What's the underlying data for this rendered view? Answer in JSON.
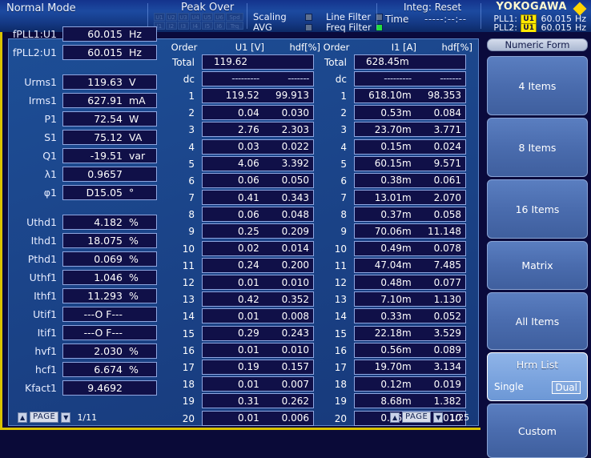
{
  "topbar": {
    "mode": "Normal Mode",
    "peak_over_title": "Peak Over",
    "peak_over_row1": [
      "U1",
      "U2",
      "U3",
      "U4",
      "U5",
      "U6",
      "Spd"
    ],
    "peak_over_row2": [
      "I1",
      "I2",
      "I3",
      "I4",
      "I5",
      "I6",
      "Trq"
    ],
    "indicators": [
      {
        "label": "Scaling",
        "state": "off"
      },
      {
        "label": "Line Filter",
        "state": "off"
      },
      {
        "label": "AVG",
        "state": "off"
      },
      {
        "label": "Freq Filter",
        "state": "on"
      }
    ],
    "integ": "Integ: Reset",
    "time_label": "Time",
    "time_value": "-----:--:--",
    "brand": "YOKOGAWA",
    "pll": [
      {
        "name": "PLL1:",
        "source": "U1",
        "value": "60.015",
        "unit": "Hz"
      },
      {
        "name": "PLL2:",
        "source": "U1",
        "value": "60.015",
        "unit": "Hz"
      }
    ]
  },
  "left_panel": {
    "group1": [
      {
        "label": "fPLL1:U1",
        "value": "60.015",
        "unit": "Hz"
      },
      {
        "label": "fPLL2:U1",
        "value": "60.015",
        "unit": "Hz"
      }
    ],
    "group2": [
      {
        "label": "Urms1",
        "value": "119.63",
        "unit": "V"
      },
      {
        "label": "Irms1",
        "value": "627.91",
        "unit": "mA"
      },
      {
        "label": "P1",
        "value": "72.54",
        "unit": "W"
      },
      {
        "label": "S1",
        "value": "75.12",
        "unit": "VA"
      },
      {
        "label": "Q1",
        "value": "-19.51",
        "unit": "var"
      },
      {
        "label": "λ1",
        "value": "0.9657",
        "unit": ""
      },
      {
        "label": "φ1",
        "value": "D15.05",
        "unit": "°"
      }
    ],
    "group3": [
      {
        "label": "Uthd1",
        "value": "4.182",
        "unit": "%"
      },
      {
        "label": "Ithd1",
        "value": "18.075",
        "unit": "%"
      },
      {
        "label": "Pthd1",
        "value": "0.069",
        "unit": "%"
      },
      {
        "label": "Uthf1",
        "value": "1.046",
        "unit": "%"
      },
      {
        "label": "Ithf1",
        "value": "11.293",
        "unit": "%"
      },
      {
        "label": "Utif1",
        "value": "---O F---",
        "unit": ""
      },
      {
        "label": "Itif1",
        "value": "---O F---",
        "unit": ""
      },
      {
        "label": "hvf1",
        "value": "2.030",
        "unit": "%"
      },
      {
        "label": "hcf1",
        "value": "6.674",
        "unit": "%"
      },
      {
        "label": "Kfact1",
        "value": "9.4692",
        "unit": ""
      }
    ],
    "page": "1/11",
    "page_label": "PAGE"
  },
  "harmonics_left": {
    "header": {
      "order": "Order",
      "value": "U1  [V]",
      "hdf": "hdf[%]"
    },
    "total": {
      "order": "Total",
      "value": "119.62",
      "hdf": ""
    },
    "dc": {
      "order": "dc",
      "value": "---------",
      "hdf": "-------"
    },
    "rows": [
      {
        "order": "1",
        "value": "119.52",
        "hdf": "99.913"
      },
      {
        "order": "2",
        "value": "0.04",
        "hdf": "0.030"
      },
      {
        "order": "3",
        "value": "2.76",
        "hdf": "2.303"
      },
      {
        "order": "4",
        "value": "0.03",
        "hdf": "0.022"
      },
      {
        "order": "5",
        "value": "4.06",
        "hdf": "3.392"
      },
      {
        "order": "6",
        "value": "0.06",
        "hdf": "0.050"
      },
      {
        "order": "7",
        "value": "0.41",
        "hdf": "0.343"
      },
      {
        "order": "8",
        "value": "0.06",
        "hdf": "0.048"
      },
      {
        "order": "9",
        "value": "0.25",
        "hdf": "0.209"
      },
      {
        "order": "10",
        "value": "0.02",
        "hdf": "0.014"
      },
      {
        "order": "11",
        "value": "0.24",
        "hdf": "0.200"
      },
      {
        "order": "12",
        "value": "0.01",
        "hdf": "0.010"
      },
      {
        "order": "13",
        "value": "0.42",
        "hdf": "0.352"
      },
      {
        "order": "14",
        "value": "0.01",
        "hdf": "0.008"
      },
      {
        "order": "15",
        "value": "0.29",
        "hdf": "0.243"
      },
      {
        "order": "16",
        "value": "0.01",
        "hdf": "0.010"
      },
      {
        "order": "17",
        "value": "0.19",
        "hdf": "0.157"
      },
      {
        "order": "18",
        "value": "0.01",
        "hdf": "0.007"
      },
      {
        "order": "19",
        "value": "0.31",
        "hdf": "0.262"
      },
      {
        "order": "20",
        "value": "0.01",
        "hdf": "0.006"
      }
    ]
  },
  "harmonics_right": {
    "header": {
      "order": "Order",
      "value": "I1  [A]",
      "hdf": "hdf[%]"
    },
    "total": {
      "order": "Total",
      "value": "628.45m",
      "hdf": ""
    },
    "dc": {
      "order": "dc",
      "value": "---------",
      "hdf": "-------"
    },
    "rows": [
      {
        "order": "1",
        "value": "618.10m",
        "hdf": "98.353"
      },
      {
        "order": "2",
        "value": "0.53m",
        "hdf": "0.084"
      },
      {
        "order": "3",
        "value": "23.70m",
        "hdf": "3.771"
      },
      {
        "order": "4",
        "value": "0.15m",
        "hdf": "0.024"
      },
      {
        "order": "5",
        "value": "60.15m",
        "hdf": "9.571"
      },
      {
        "order": "6",
        "value": "0.38m",
        "hdf": "0.061"
      },
      {
        "order": "7",
        "value": "13.01m",
        "hdf": "2.070"
      },
      {
        "order": "8",
        "value": "0.37m",
        "hdf": "0.058"
      },
      {
        "order": "9",
        "value": "70.06m",
        "hdf": "11.148"
      },
      {
        "order": "10",
        "value": "0.49m",
        "hdf": "0.078"
      },
      {
        "order": "11",
        "value": "47.04m",
        "hdf": "7.485"
      },
      {
        "order": "12",
        "value": "0.48m",
        "hdf": "0.077"
      },
      {
        "order": "13",
        "value": "7.10m",
        "hdf": "1.130"
      },
      {
        "order": "14",
        "value": "0.33m",
        "hdf": "0.052"
      },
      {
        "order": "15",
        "value": "22.18m",
        "hdf": "3.529"
      },
      {
        "order": "16",
        "value": "0.56m",
        "hdf": "0.089"
      },
      {
        "order": "17",
        "value": "19.70m",
        "hdf": "3.134"
      },
      {
        "order": "18",
        "value": "0.12m",
        "hdf": "0.019"
      },
      {
        "order": "19",
        "value": "8.68m",
        "hdf": "1.382"
      },
      {
        "order": "20",
        "value": "0.06m",
        "hdf": "0.010"
      }
    ],
    "page": "1/25",
    "page_label": "PAGE"
  },
  "menu": {
    "title": "Numeric Form",
    "keys": [
      {
        "label": "4 Items",
        "selected": false
      },
      {
        "label": "8 Items",
        "selected": false
      },
      {
        "label": "16 Items",
        "selected": false
      },
      {
        "label": "Matrix",
        "selected": false
      },
      {
        "label": "All Items",
        "selected": false
      },
      {
        "label": "Hrm List",
        "selected": true,
        "options": [
          "Single",
          "Dual"
        ],
        "active_option": "Dual"
      },
      {
        "label": "Custom",
        "selected": false
      }
    ]
  },
  "colors": {
    "accent_yellow": "#ffe800",
    "frame_yellow": "#d9c200",
    "panel_blue": "#1d4e96",
    "value_box": "#101048",
    "status_on_green": "#22e03c",
    "background": "#0a0a3c"
  }
}
